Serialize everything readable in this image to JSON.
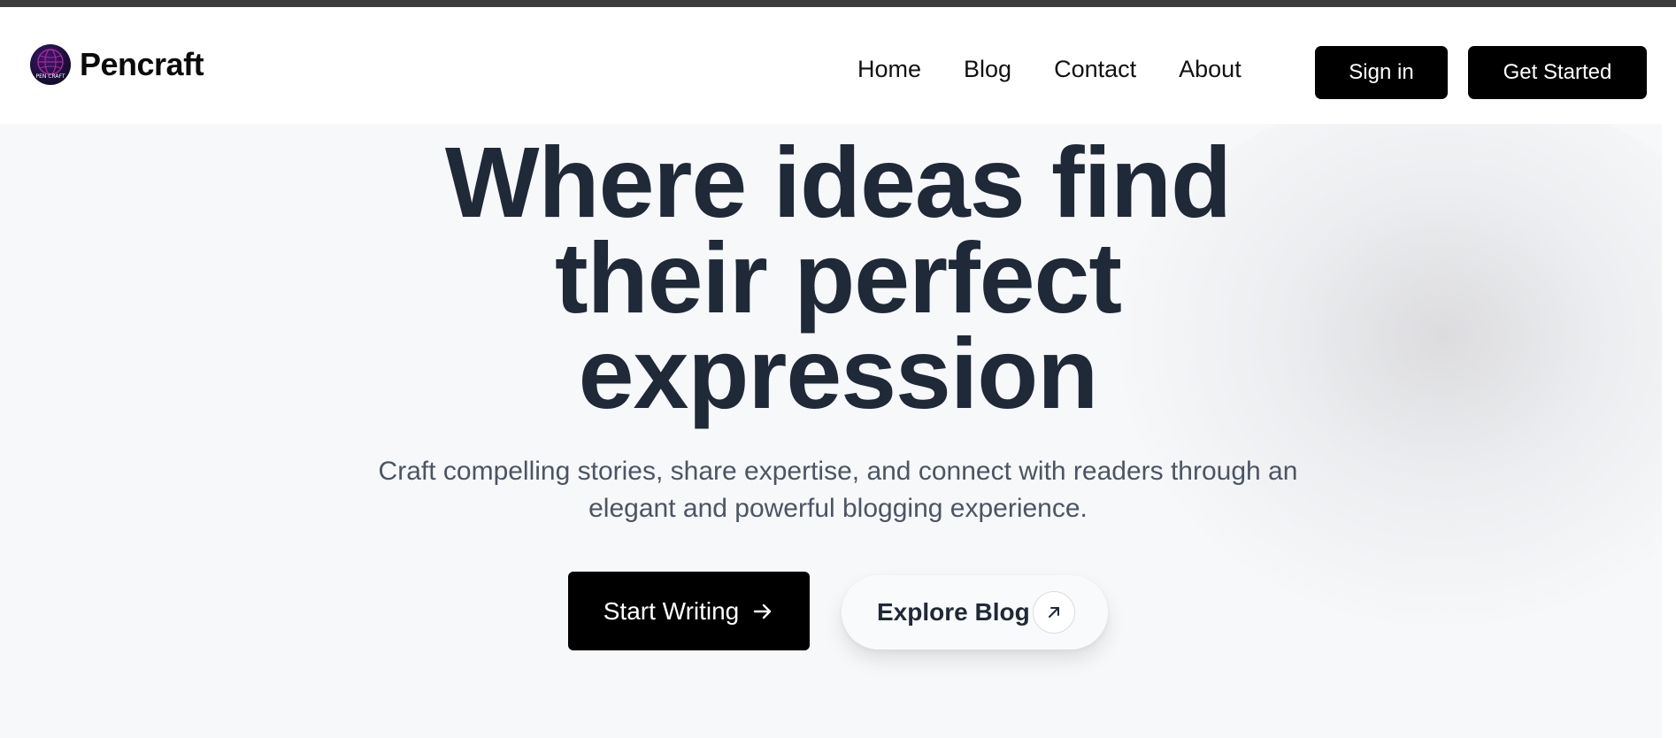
{
  "brand": {
    "name": "Pencraft",
    "logo_icon": "pencraft-globe-logo",
    "logo_text_small": "PEN CRAFT"
  },
  "nav": {
    "links": [
      "Home",
      "Blog",
      "Contact",
      "About"
    ],
    "signin_label": "Sign in",
    "get_started_label": "Get Started"
  },
  "hero": {
    "title_lines": [
      "Where ideas find",
      "their perfect",
      "expression"
    ],
    "subtitle_lines": [
      "Craft compelling stories, share expertise, and connect with readers through an",
      "elegant and powerful blogging experience."
    ],
    "start_writing_label": "Start Writing",
    "start_writing_icon": "arrow-right-icon",
    "explore_blog_label": "Explore Blog",
    "explore_blog_icon": "arrow-up-right-icon"
  },
  "colors": {
    "topbar": "#3c3c3c",
    "primary_button": "#000000",
    "heading": "#1f2937",
    "subtitle": "#4b5563",
    "hero_bg": "#f7f8fa"
  }
}
